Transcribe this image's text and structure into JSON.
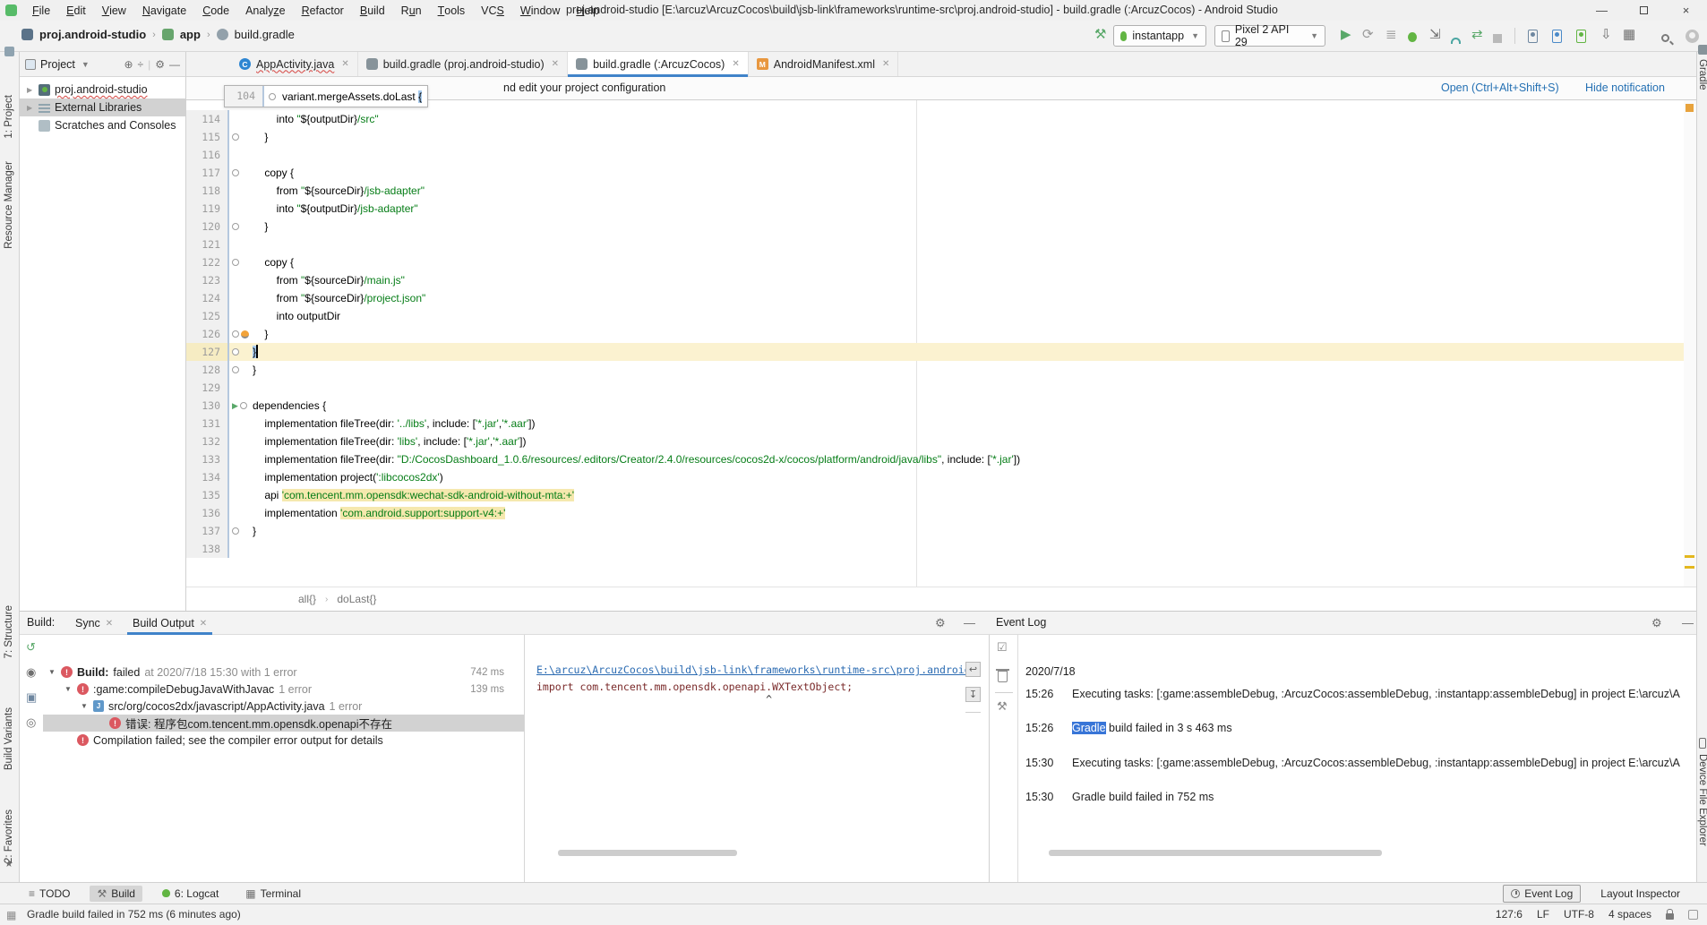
{
  "titlebar": {
    "title": "proj.android-studio [E:\\arcuz\\ArcuzCocos\\build\\jsb-link\\frameworks\\runtime-src\\proj.android-studio] - build.gradle (:ArcuzCocos) - Android Studio",
    "menus": [
      {
        "label": "File",
        "u": 0
      },
      {
        "label": "Edit",
        "u": 0
      },
      {
        "label": "View",
        "u": 0
      },
      {
        "label": "Navigate",
        "u": 0
      },
      {
        "label": "Code",
        "u": 0
      },
      {
        "label": "Analyze",
        "u": 5
      },
      {
        "label": "Refactor",
        "u": 0
      },
      {
        "label": "Build",
        "u": 0
      },
      {
        "label": "Run",
        "u": 1
      },
      {
        "label": "Tools",
        "u": 0
      },
      {
        "label": "VCS",
        "u": 2
      },
      {
        "label": "Window",
        "u": 0
      },
      {
        "label": "Help",
        "u": 0
      }
    ],
    "controls": {
      "minimize": "—",
      "maximize": "",
      "close": "×"
    }
  },
  "toolbar": {
    "breadcrumbs": [
      {
        "label": "proj.android-studio",
        "bold": true,
        "icon": "as"
      },
      {
        "label": "app",
        "bold": true,
        "icon": "app"
      },
      {
        "label": "build.gradle",
        "bold": false,
        "icon": "gr"
      }
    ],
    "run_config": "instantapp",
    "device": "Pixel 2 API 29"
  },
  "stripes": {
    "left_top": [
      "1: Project",
      "Resource Manager"
    ],
    "left_bottom": [
      "7: Structure",
      "Build Variants",
      "2: Favorites"
    ],
    "right_top": [
      "Gradle"
    ],
    "right_bottom": [
      "Device File Explorer"
    ]
  },
  "project": {
    "title": "Project",
    "items": [
      {
        "label": "proj.android-studio",
        "icon": "proj",
        "chevron": true,
        "squiggle": true,
        "selected": false
      },
      {
        "label": "External Libraries",
        "icon": "lib",
        "chevron": true,
        "squiggle": false,
        "selected": true
      },
      {
        "label": "Scratches and Consoles",
        "icon": "scr",
        "chevron": false,
        "squiggle": false,
        "selected": false
      }
    ]
  },
  "tabs": [
    {
      "label": "AppActivity.java",
      "icon": "java",
      "squiggle": true,
      "active": false
    },
    {
      "label": "build.gradle (proj.android-studio)",
      "icon": "gradle",
      "squiggle": false,
      "active": false
    },
    {
      "label": "build.gradle (:ArcuzCocos)",
      "icon": "gradle",
      "squiggle": false,
      "active": true
    },
    {
      "label": "AndroidManifest.xml",
      "icon": "manifest",
      "squiggle": false,
      "active": false
    }
  ],
  "banner": {
    "message": "nd edit your project configuration",
    "open_link": "Open (Ctrl+Alt+Shift+S)",
    "hide_link": "Hide notification"
  },
  "lens": {
    "line": "104",
    "code": "variant.mergeAssets.doLast ",
    "brace": "{"
  },
  "editor": {
    "breadcrumbs": [
      "all{}",
      "doLast{}"
    ],
    "lines": [
      {
        "n": "114",
        "seg": [
          [
            "p",
            "        into "
          ],
          [
            "s",
            "\""
          ],
          [
            "p",
            "${outputDir}"
          ],
          [
            "s",
            "/src\""
          ]
        ]
      },
      {
        "n": "115",
        "fold": true,
        "seg": [
          [
            "p",
            "    }"
          ]
        ]
      },
      {
        "n": "116",
        "seg": []
      },
      {
        "n": "117",
        "fold": true,
        "seg": [
          [
            "p",
            "    copy {"
          ]
        ]
      },
      {
        "n": "118",
        "seg": [
          [
            "p",
            "        from "
          ],
          [
            "s",
            "\""
          ],
          [
            "p",
            "${sourceDir}"
          ],
          [
            "s",
            "/jsb-adapter\""
          ]
        ]
      },
      {
        "n": "119",
        "seg": [
          [
            "p",
            "        into "
          ],
          [
            "s",
            "\""
          ],
          [
            "p",
            "${outputDir}"
          ],
          [
            "s",
            "/jsb-adapter\""
          ]
        ]
      },
      {
        "n": "120",
        "fold": true,
        "seg": [
          [
            "p",
            "    }"
          ]
        ]
      },
      {
        "n": "121",
        "seg": []
      },
      {
        "n": "122",
        "fold": true,
        "seg": [
          [
            "p",
            "    copy {"
          ]
        ]
      },
      {
        "n": "123",
        "seg": [
          [
            "p",
            "        from "
          ],
          [
            "s",
            "\""
          ],
          [
            "p",
            "${sourceDir}"
          ],
          [
            "s",
            "/main.js\""
          ]
        ]
      },
      {
        "n": "124",
        "seg": [
          [
            "p",
            "        from "
          ],
          [
            "s",
            "\""
          ],
          [
            "p",
            "${sourceDir}"
          ],
          [
            "s",
            "/project.json\""
          ]
        ]
      },
      {
        "n": "125",
        "seg": [
          [
            "p",
            "        into outputDir"
          ]
        ]
      },
      {
        "n": "126",
        "fold": true,
        "bulb": true,
        "seg": [
          [
            "p",
            "    }"
          ]
        ]
      },
      {
        "n": "127",
        "fold": true,
        "current": true,
        "caret": true,
        "seg": [
          [
            "b",
            "}"
          ]
        ]
      },
      {
        "n": "128",
        "fold": true,
        "seg": [
          [
            "p",
            "}"
          ]
        ]
      },
      {
        "n": "129",
        "seg": []
      },
      {
        "n": "130",
        "fold": true,
        "run": true,
        "seg": [
          [
            "p",
            "dependencies {"
          ]
        ]
      },
      {
        "n": "131",
        "seg": [
          [
            "p",
            "    implementation fileTree(dir: "
          ],
          [
            "s",
            "'../libs'"
          ],
          [
            "p",
            ", include: ["
          ],
          [
            "s",
            "'*.jar'"
          ],
          [
            "p",
            ","
          ],
          [
            "s",
            "'*.aar'"
          ],
          [
            "p",
            "])"
          ]
        ]
      },
      {
        "n": "132",
        "seg": [
          [
            "p",
            "    implementation fileTree(dir: "
          ],
          [
            "s",
            "'libs'"
          ],
          [
            "p",
            ", include: ["
          ],
          [
            "s",
            "'*.jar'"
          ],
          [
            "p",
            ","
          ],
          [
            "s",
            "'*.aar'"
          ],
          [
            "p",
            "])"
          ]
        ]
      },
      {
        "n": "133",
        "seg": [
          [
            "p",
            "    implementation fileTree(dir: "
          ],
          [
            "s",
            "\"D:/CocosDashboard_1.0.6/resources/.editors/Creator/2.4.0/resources/cocos2d-x/cocos/platform/android/java/libs\""
          ],
          [
            "p",
            ", include: ["
          ],
          [
            "s",
            "'*.jar'"
          ],
          [
            "p",
            "])"
          ]
        ]
      },
      {
        "n": "134",
        "seg": [
          [
            "p",
            "    implementation project("
          ],
          [
            "s",
            "':libcocos2dx'"
          ],
          [
            "p",
            ")"
          ]
        ]
      },
      {
        "n": "135",
        "seg": [
          [
            "p",
            "    api "
          ],
          [
            "w",
            "'com.tencent.mm.opensdk:wechat-sdk-android-without-mta:+'"
          ]
        ]
      },
      {
        "n": "136",
        "seg": [
          [
            "p",
            "    implementation "
          ],
          [
            "w",
            "'com.android.support:support-v4:+'"
          ]
        ]
      },
      {
        "n": "137",
        "fold": true,
        "seg": [
          [
            "p",
            "}"
          ]
        ]
      },
      {
        "n": "138",
        "seg": []
      }
    ]
  },
  "build": {
    "label": "Build:",
    "tabs": [
      {
        "label": "Sync",
        "active": false
      },
      {
        "label": "Build Output",
        "active": true
      }
    ],
    "tree": [
      {
        "indent": 0,
        "expanded": true,
        "icon": "error",
        "bold": "Build: ",
        "text": "failed",
        "dim": " at 2020/7/18 15:30 with 1 error",
        "time": "742 ms",
        "selected": false
      },
      {
        "indent": 1,
        "expanded": true,
        "icon": "error",
        "bold": "",
        "text": ":game:compileDebugJavaWithJavac",
        "dim": " 1 error",
        "time": "139 ms",
        "selected": false
      },
      {
        "indent": 2,
        "expanded": true,
        "icon": "java",
        "bold": "",
        "text": "src/org/cocos2dx/javascript/AppActivity.java",
        "dim": " 1 error",
        "time": "",
        "selected": false
      },
      {
        "indent": 3,
        "expanded": false,
        "icon": "error",
        "bold": "",
        "text": "错误: 程序包com.tencent.mm.opensdk.openapi不存在",
        "dim": "",
        "time": "",
        "selected": true
      },
      {
        "indent": 1,
        "expanded": false,
        "icon": "error",
        "bold": "",
        "text": "Compilation failed; see the compiler error output for details",
        "dim": "",
        "time": "",
        "selected": false
      }
    ]
  },
  "console": {
    "link": "E:\\arcuz\\ArcuzCocos\\build\\jsb-link\\frameworks\\runtime-src\\proj.android-",
    "code": "import com.tencent.mm.opensdk.openapi.WXTextObject;",
    "caret": "                                     ^"
  },
  "event_log": {
    "title": "Event Log",
    "rows": [
      {
        "time": "2020/7/18",
        "hl": "",
        "text": ""
      },
      {
        "time": "15:26",
        "hl": "",
        "text": "Executing tasks: [:game:assembleDebug, :ArcuzCocos:assembleDebug, :instantapp:assembleDebug] in project E:\\arcuz\\A"
      },
      {
        "time": "15:26",
        "hl": "Gradle",
        "text": " build failed in 3 s 463 ms"
      },
      {
        "time": "15:30",
        "hl": "",
        "text": "Executing tasks: [:game:assembleDebug, :ArcuzCocos:assembleDebug, :instantapp:assembleDebug] in project E:\\arcuz\\A"
      },
      {
        "time": "15:30",
        "hl": "",
        "text": "Gradle build failed in 752 ms"
      }
    ]
  },
  "bottom_bar": {
    "left": [
      {
        "label": "TODO",
        "icon": "todo",
        "active": false
      },
      {
        "label": "Build",
        "icon": "hammer",
        "active": true
      },
      {
        "label": "6: Logcat",
        "icon": "logcat",
        "active": false
      },
      {
        "label": "Terminal",
        "icon": "terminal",
        "active": false
      }
    ],
    "right": [
      {
        "label": "Event Log",
        "icon": "clock",
        "boxed": true
      },
      {
        "label": "Layout Inspector",
        "icon": "",
        "boxed": false
      }
    ]
  },
  "status_bar": {
    "message": "Gradle build failed in 752 ms (6 minutes ago)",
    "position": "127:6",
    "line_sep": "LF",
    "encoding": "UTF-8",
    "indent": "4 spaces"
  }
}
